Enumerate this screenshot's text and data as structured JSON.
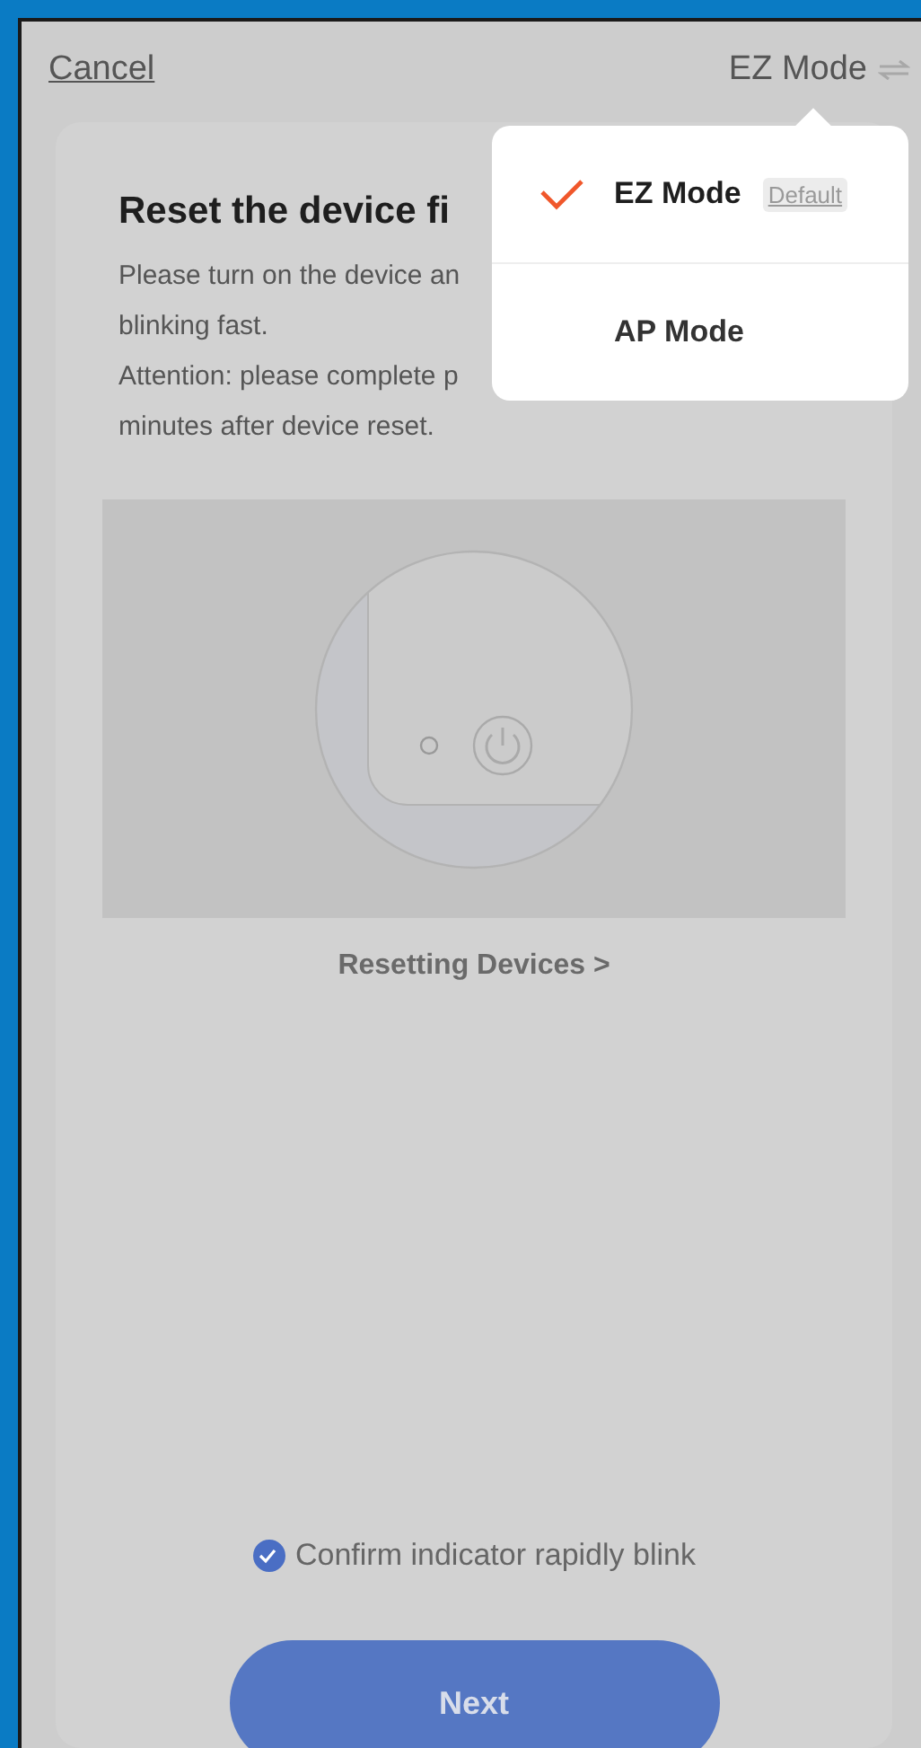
{
  "header": {
    "cancel": "Cancel",
    "mode": "EZ Mode"
  },
  "instructions": {
    "title": "Reset the device fi",
    "lines": [
      "Please turn on the device an",
      "blinking fast.",
      "Attention: please complete p",
      "minutes after device reset."
    ]
  },
  "help_link": "Resetting Devices >",
  "confirm": {
    "label": "Confirm indicator rapidly blink",
    "checked": true
  },
  "next_button": "Next",
  "mode_menu": [
    {
      "label": "EZ Mode",
      "selected": true,
      "badge": "Default"
    },
    {
      "label": "AP Mode",
      "selected": false
    }
  ]
}
